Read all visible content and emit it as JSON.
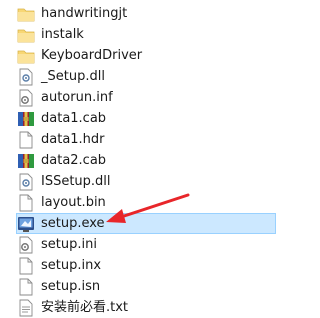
{
  "files": [
    {
      "name": "handwritingjt",
      "icon": "folder-icon"
    },
    {
      "name": "instalk",
      "icon": "folder-icon"
    },
    {
      "name": "KeyboardDriver",
      "icon": "folder-icon"
    },
    {
      "name": "_Setup.dll",
      "icon": "dll-file-icon"
    },
    {
      "name": "autorun.inf",
      "icon": "inf-file-icon"
    },
    {
      "name": "data1.cab",
      "icon": "archive-icon"
    },
    {
      "name": "data1.hdr",
      "icon": "blank-file-icon"
    },
    {
      "name": "data2.cab",
      "icon": "archive-icon"
    },
    {
      "name": "ISSetup.dll",
      "icon": "dll-file-icon"
    },
    {
      "name": "layout.bin",
      "icon": "blank-file-icon"
    },
    {
      "name": "setup.exe",
      "icon": "setup-exe-icon",
      "selected": true
    },
    {
      "name": "setup.ini",
      "icon": "ini-file-icon"
    },
    {
      "name": "setup.inx",
      "icon": "blank-file-icon"
    },
    {
      "name": "setup.isn",
      "icon": "blank-file-icon"
    },
    {
      "name": "安装前必看.txt",
      "icon": "text-file-icon"
    }
  ],
  "colors": {
    "selection": "#cce8ff",
    "selection_border": "#99d1ff",
    "arrow": "#e8262a",
    "folder": "#f8d775"
  },
  "annotation": {
    "icon": "red-arrow-icon",
    "points_to": "setup.exe"
  }
}
